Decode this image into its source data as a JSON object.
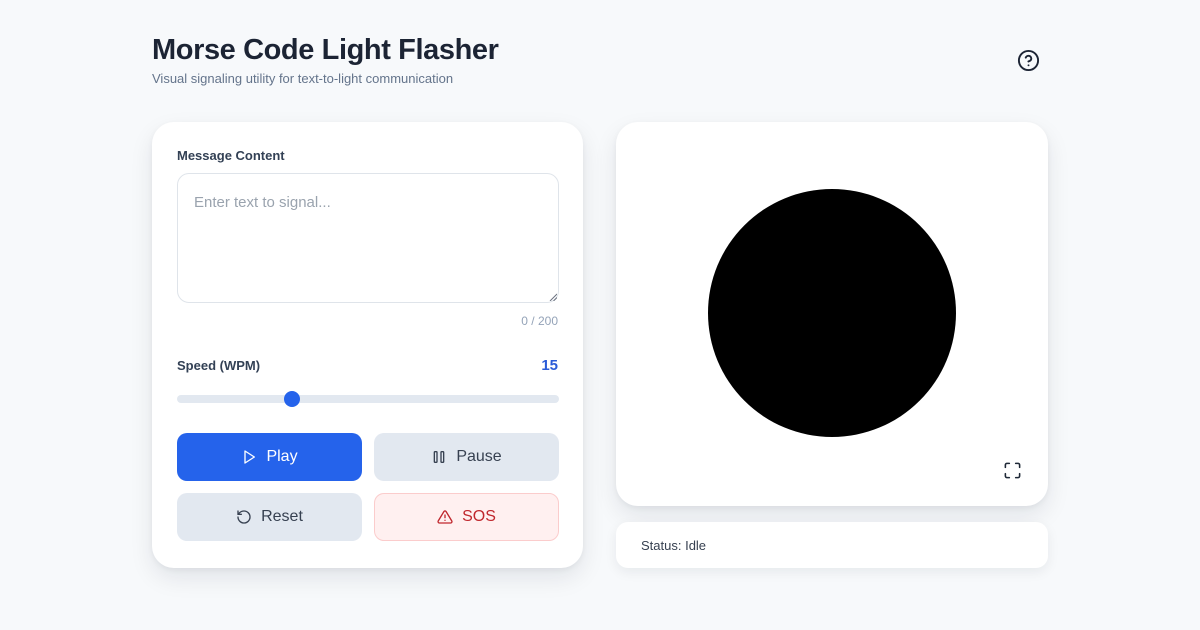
{
  "header": {
    "title": "Morse Code Light Flasher",
    "subtitle": "Visual signaling utility for text-to-light communication",
    "help_icon": "help-circle-icon"
  },
  "message": {
    "label": "Message Content",
    "placeholder": "Enter text to signal...",
    "value": "",
    "char_count": "0 / 200"
  },
  "speed": {
    "label": "Speed (WPM)",
    "value": "15",
    "level": 0.3
  },
  "buttons": {
    "play": {
      "label": "Play",
      "icon": "play-icon"
    },
    "pause": {
      "label": "Pause",
      "icon": "pause-icon"
    },
    "reset": {
      "label": "Reset",
      "icon": "rotate-ccw-icon"
    },
    "sos": {
      "label": "SOS",
      "icon": "alert-triangle-icon"
    }
  },
  "display": {
    "light_color": "#000000",
    "fullscreen_icon": "fullscreen-icon"
  },
  "status": {
    "text": "Status: Idle"
  },
  "colors": {
    "accent": "#2563eb",
    "danger": "#c0272d",
    "danger_bg": "#fff0f0",
    "background": "#f7f9fb"
  }
}
